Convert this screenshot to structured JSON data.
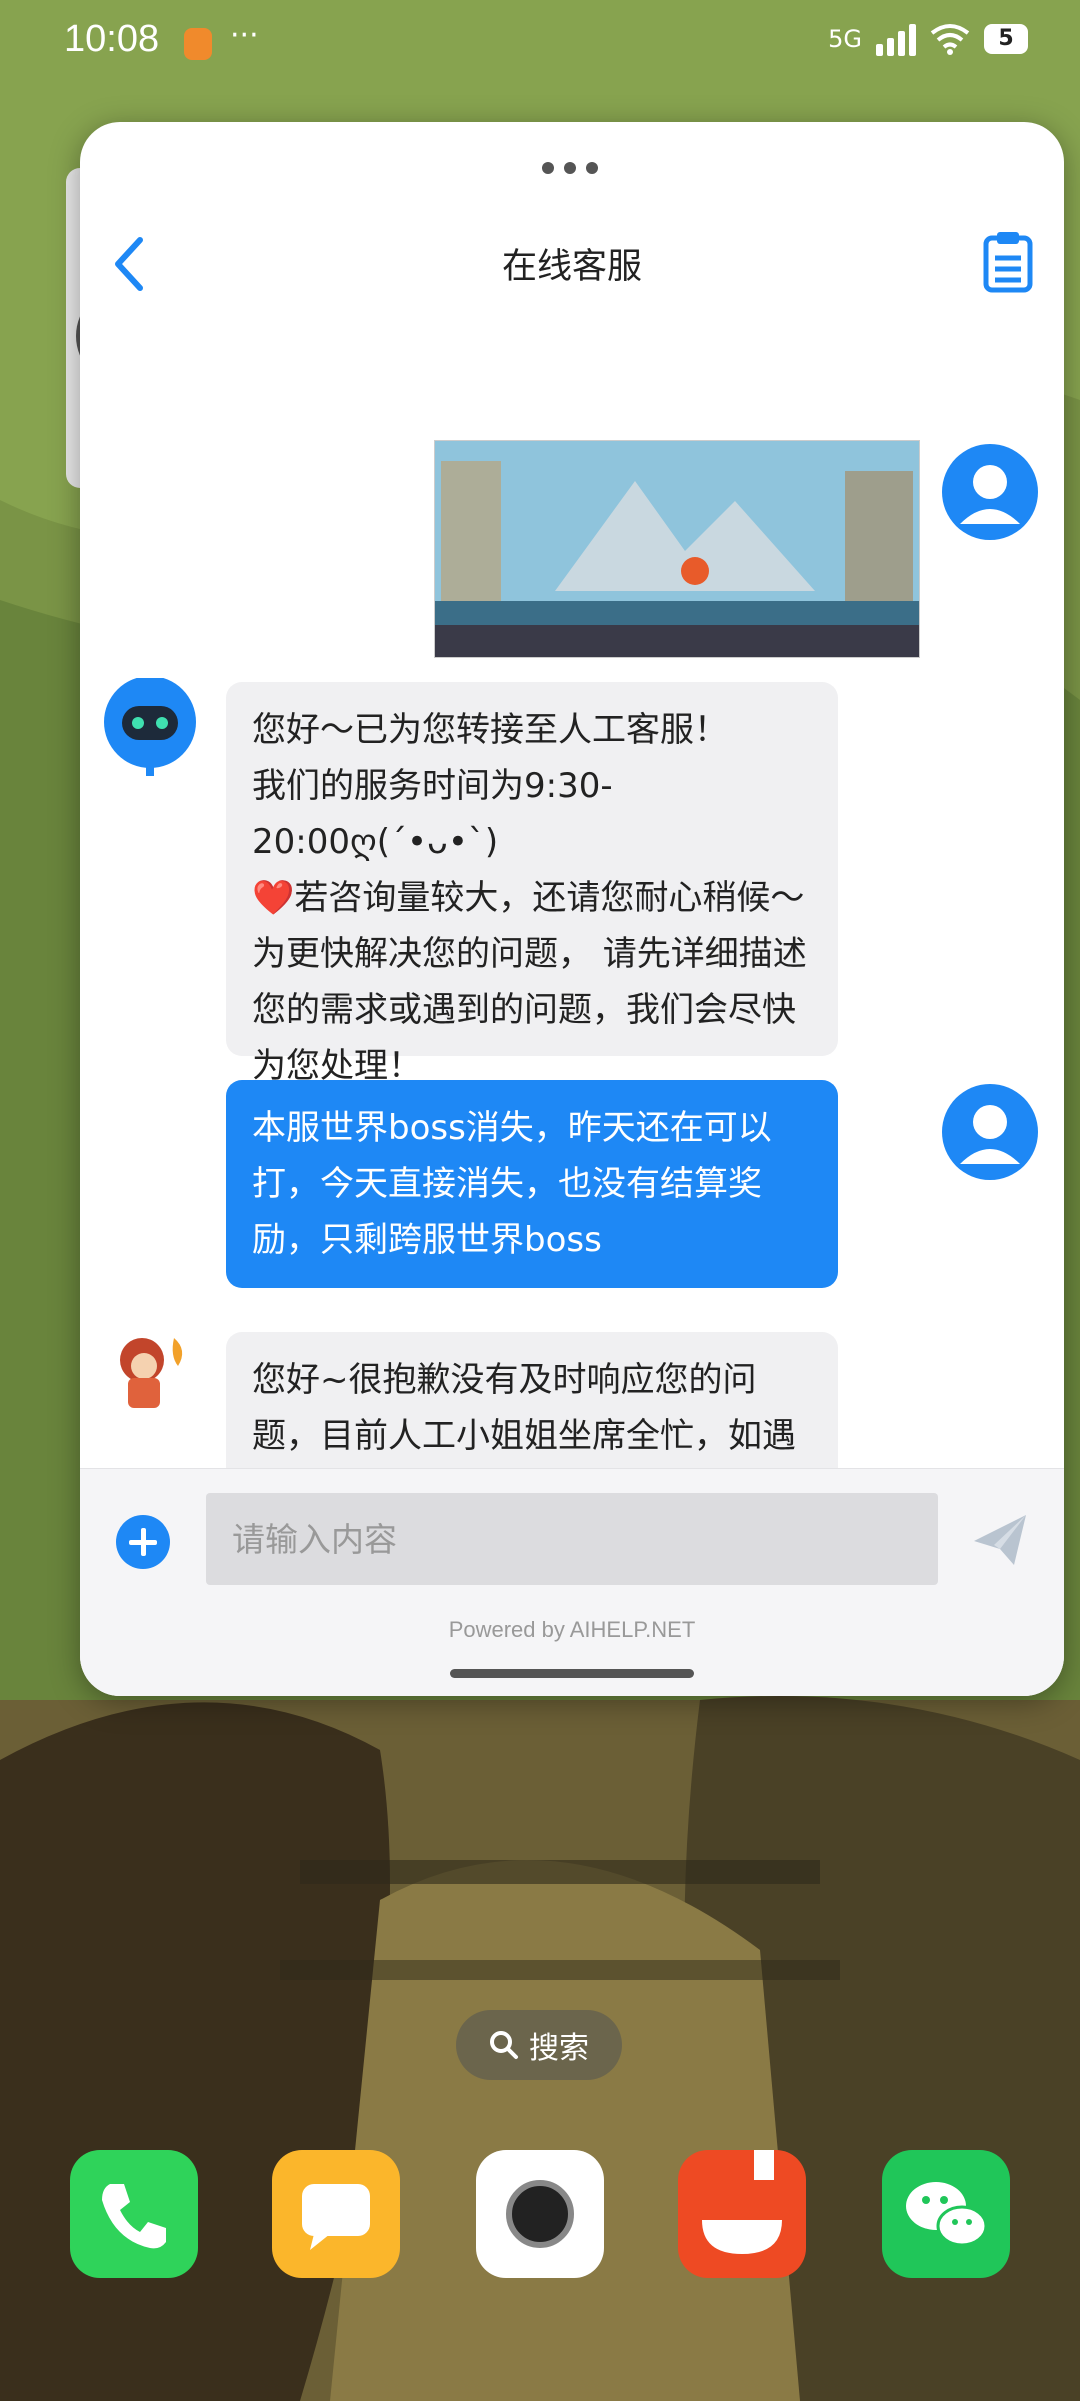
{
  "status_bar": {
    "time": "10:08",
    "overflow_dots": "···",
    "network_label": "5G",
    "battery": "5"
  },
  "chat_window": {
    "title": "在线客服",
    "messages": [
      {
        "sender": "user",
        "type": "image"
      },
      {
        "sender": "bot",
        "type": "text",
        "text": "您好～已为您转接至人工客服！\n我们的服务时间为9:30-20:00ღ(´•ᴗ•`)\n❤️若咨询量较大，还请您耐心稍候～\n为更快解决您的问题， 请先详细描述您的需求或遇到的问题，我们会尽快为您处理！"
      },
      {
        "sender": "user",
        "type": "text",
        "text": "本服世界boss消失，昨天还在可以打，今天直接消失，也没有结算奖励，只剩跨服世界boss"
      },
      {
        "sender": "agent",
        "type": "text",
        "text": "您好~很抱歉没有及时响应您的问题，目前人工小姐姐坐席全忙，如遇咨询人数较多可能需要排队等待回复，还请您再耐心等候下呢~"
      }
    ],
    "input": {
      "placeholder": "请输入内容",
      "value": ""
    },
    "powered_by": "Powered by AIHELP.NET"
  },
  "home_screen": {
    "search_label": "搜索",
    "dock_apps": [
      {
        "name": "phone",
        "color": "#2fd35a"
      },
      {
        "name": "messages",
        "color": "#fbb62b"
      },
      {
        "name": "camera",
        "color": "#ffffff"
      },
      {
        "name": "tomato-novel",
        "color": "#ee4a23"
      },
      {
        "name": "wechat",
        "color": "#20c659"
      }
    ]
  },
  "colors": {
    "accent": "#1e88f5",
    "bubble_gray": "#f0f0f2"
  }
}
